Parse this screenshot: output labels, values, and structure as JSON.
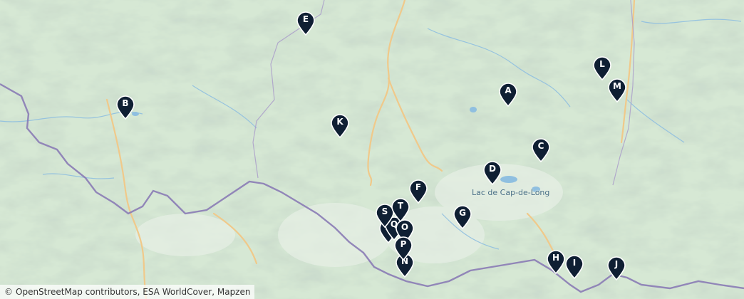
{
  "map": {
    "lake_label": "Lac de Cap-de-Long",
    "colors": {
      "land": "#cfe3cf",
      "border": "#8a7bb5",
      "road": "#f0c98a",
      "water": "#8fbfe0",
      "marker": "#0f1f33"
    }
  },
  "markers": [
    {
      "letter": "A"
    },
    {
      "letter": "B"
    },
    {
      "letter": "C"
    },
    {
      "letter": "D"
    },
    {
      "letter": "E"
    },
    {
      "letter": "F"
    },
    {
      "letter": "G"
    },
    {
      "letter": "H"
    },
    {
      "letter": "I"
    },
    {
      "letter": "J"
    },
    {
      "letter": "K"
    },
    {
      "letter": "L"
    },
    {
      "letter": "M"
    },
    {
      "letter": "N"
    },
    {
      "letter": "O"
    },
    {
      "letter": "P"
    },
    {
      "letter": "Q"
    },
    {
      "letter": "R"
    },
    {
      "letter": "S"
    },
    {
      "letter": "T"
    }
  ],
  "attribution": {
    "icon": "copyright-icon",
    "text": "OpenStreetMap contributors, ESA WorldCover, Mapzen"
  }
}
